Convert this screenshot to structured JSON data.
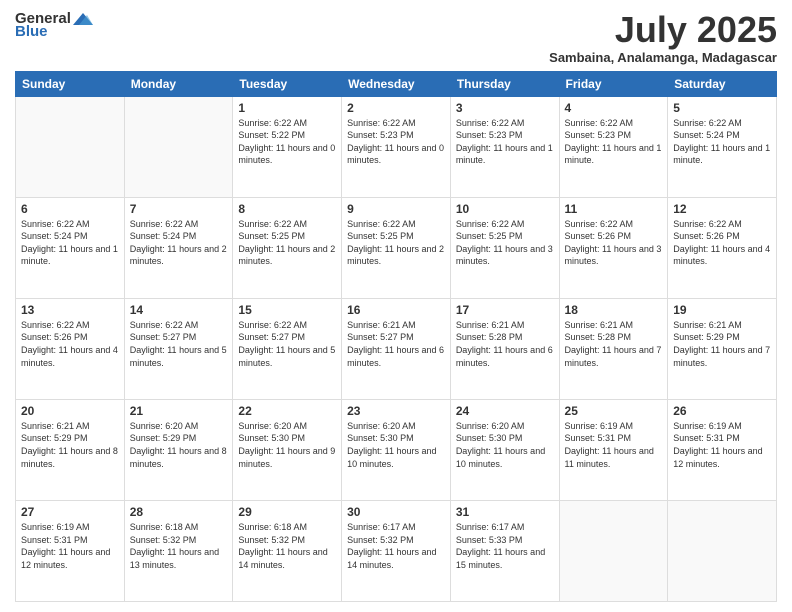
{
  "header": {
    "logo_general": "General",
    "logo_blue": "Blue",
    "month_year": "July 2025",
    "location": "Sambaina, Analamanga, Madagascar"
  },
  "days_of_week": [
    "Sunday",
    "Monday",
    "Tuesday",
    "Wednesday",
    "Thursday",
    "Friday",
    "Saturday"
  ],
  "weeks": [
    [
      {
        "day": "",
        "sunrise": "",
        "sunset": "",
        "daylight": "",
        "empty": true
      },
      {
        "day": "",
        "sunrise": "",
        "sunset": "",
        "daylight": "",
        "empty": true
      },
      {
        "day": "1",
        "sunrise": "Sunrise: 6:22 AM",
        "sunset": "Sunset: 5:22 PM",
        "daylight": "Daylight: 11 hours and 0 minutes."
      },
      {
        "day": "2",
        "sunrise": "Sunrise: 6:22 AM",
        "sunset": "Sunset: 5:23 PM",
        "daylight": "Daylight: 11 hours and 0 minutes."
      },
      {
        "day": "3",
        "sunrise": "Sunrise: 6:22 AM",
        "sunset": "Sunset: 5:23 PM",
        "daylight": "Daylight: 11 hours and 1 minute."
      },
      {
        "day": "4",
        "sunrise": "Sunrise: 6:22 AM",
        "sunset": "Sunset: 5:23 PM",
        "daylight": "Daylight: 11 hours and 1 minute."
      },
      {
        "day": "5",
        "sunrise": "Sunrise: 6:22 AM",
        "sunset": "Sunset: 5:24 PM",
        "daylight": "Daylight: 11 hours and 1 minute."
      }
    ],
    [
      {
        "day": "6",
        "sunrise": "Sunrise: 6:22 AM",
        "sunset": "Sunset: 5:24 PM",
        "daylight": "Daylight: 11 hours and 1 minute."
      },
      {
        "day": "7",
        "sunrise": "Sunrise: 6:22 AM",
        "sunset": "Sunset: 5:24 PM",
        "daylight": "Daylight: 11 hours and 2 minutes."
      },
      {
        "day": "8",
        "sunrise": "Sunrise: 6:22 AM",
        "sunset": "Sunset: 5:25 PM",
        "daylight": "Daylight: 11 hours and 2 minutes."
      },
      {
        "day": "9",
        "sunrise": "Sunrise: 6:22 AM",
        "sunset": "Sunset: 5:25 PM",
        "daylight": "Daylight: 11 hours and 2 minutes."
      },
      {
        "day": "10",
        "sunrise": "Sunrise: 6:22 AM",
        "sunset": "Sunset: 5:25 PM",
        "daylight": "Daylight: 11 hours and 3 minutes."
      },
      {
        "day": "11",
        "sunrise": "Sunrise: 6:22 AM",
        "sunset": "Sunset: 5:26 PM",
        "daylight": "Daylight: 11 hours and 3 minutes."
      },
      {
        "day": "12",
        "sunrise": "Sunrise: 6:22 AM",
        "sunset": "Sunset: 5:26 PM",
        "daylight": "Daylight: 11 hours and 4 minutes."
      }
    ],
    [
      {
        "day": "13",
        "sunrise": "Sunrise: 6:22 AM",
        "sunset": "Sunset: 5:26 PM",
        "daylight": "Daylight: 11 hours and 4 minutes."
      },
      {
        "day": "14",
        "sunrise": "Sunrise: 6:22 AM",
        "sunset": "Sunset: 5:27 PM",
        "daylight": "Daylight: 11 hours and 5 minutes."
      },
      {
        "day": "15",
        "sunrise": "Sunrise: 6:22 AM",
        "sunset": "Sunset: 5:27 PM",
        "daylight": "Daylight: 11 hours and 5 minutes."
      },
      {
        "day": "16",
        "sunrise": "Sunrise: 6:21 AM",
        "sunset": "Sunset: 5:27 PM",
        "daylight": "Daylight: 11 hours and 6 minutes."
      },
      {
        "day": "17",
        "sunrise": "Sunrise: 6:21 AM",
        "sunset": "Sunset: 5:28 PM",
        "daylight": "Daylight: 11 hours and 6 minutes."
      },
      {
        "day": "18",
        "sunrise": "Sunrise: 6:21 AM",
        "sunset": "Sunset: 5:28 PM",
        "daylight": "Daylight: 11 hours and 7 minutes."
      },
      {
        "day": "19",
        "sunrise": "Sunrise: 6:21 AM",
        "sunset": "Sunset: 5:29 PM",
        "daylight": "Daylight: 11 hours and 7 minutes."
      }
    ],
    [
      {
        "day": "20",
        "sunrise": "Sunrise: 6:21 AM",
        "sunset": "Sunset: 5:29 PM",
        "daylight": "Daylight: 11 hours and 8 minutes."
      },
      {
        "day": "21",
        "sunrise": "Sunrise: 6:20 AM",
        "sunset": "Sunset: 5:29 PM",
        "daylight": "Daylight: 11 hours and 8 minutes."
      },
      {
        "day": "22",
        "sunrise": "Sunrise: 6:20 AM",
        "sunset": "Sunset: 5:30 PM",
        "daylight": "Daylight: 11 hours and 9 minutes."
      },
      {
        "day": "23",
        "sunrise": "Sunrise: 6:20 AM",
        "sunset": "Sunset: 5:30 PM",
        "daylight": "Daylight: 11 hours and 10 minutes."
      },
      {
        "day": "24",
        "sunrise": "Sunrise: 6:20 AM",
        "sunset": "Sunset: 5:30 PM",
        "daylight": "Daylight: 11 hours and 10 minutes."
      },
      {
        "day": "25",
        "sunrise": "Sunrise: 6:19 AM",
        "sunset": "Sunset: 5:31 PM",
        "daylight": "Daylight: 11 hours and 11 minutes."
      },
      {
        "day": "26",
        "sunrise": "Sunrise: 6:19 AM",
        "sunset": "Sunset: 5:31 PM",
        "daylight": "Daylight: 11 hours and 12 minutes."
      }
    ],
    [
      {
        "day": "27",
        "sunrise": "Sunrise: 6:19 AM",
        "sunset": "Sunset: 5:31 PM",
        "daylight": "Daylight: 11 hours and 12 minutes."
      },
      {
        "day": "28",
        "sunrise": "Sunrise: 6:18 AM",
        "sunset": "Sunset: 5:32 PM",
        "daylight": "Daylight: 11 hours and 13 minutes."
      },
      {
        "day": "29",
        "sunrise": "Sunrise: 6:18 AM",
        "sunset": "Sunset: 5:32 PM",
        "daylight": "Daylight: 11 hours and 14 minutes."
      },
      {
        "day": "30",
        "sunrise": "Sunrise: 6:17 AM",
        "sunset": "Sunset: 5:32 PM",
        "daylight": "Daylight: 11 hours and 14 minutes."
      },
      {
        "day": "31",
        "sunrise": "Sunrise: 6:17 AM",
        "sunset": "Sunset: 5:33 PM",
        "daylight": "Daylight: 11 hours and 15 minutes."
      },
      {
        "day": "",
        "sunrise": "",
        "sunset": "",
        "daylight": "",
        "empty": true
      },
      {
        "day": "",
        "sunrise": "",
        "sunset": "",
        "daylight": "",
        "empty": true
      }
    ]
  ]
}
